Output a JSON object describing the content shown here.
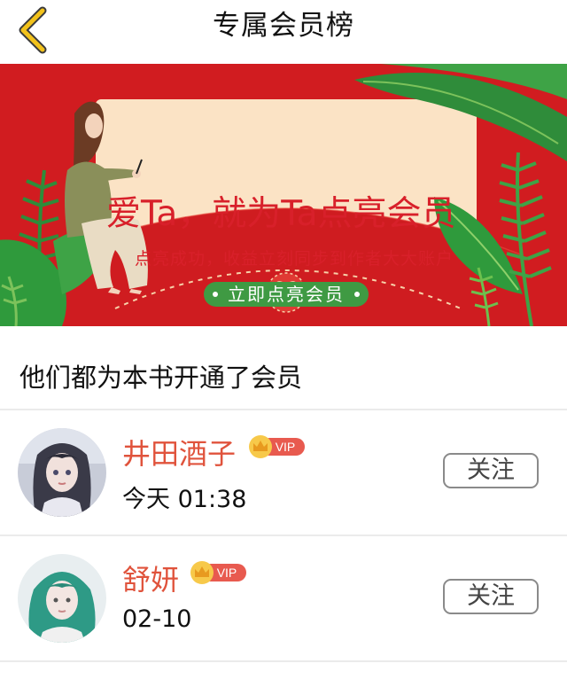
{
  "header": {
    "title": "专属会员榜",
    "back_icon": "chevron-left-icon",
    "back_color": "#f2c21b"
  },
  "banner": {
    "headline": "爱Ta，就为Ta点亮会员",
    "subline": "点亮成功，收益立刻同步到作者大大账户",
    "cta_label": "立即点亮会员",
    "background_color": "#d41e22",
    "card_color": "#fbe3c5",
    "cta_color": "#3f9a43",
    "seal_icon": "heart-seal-icon"
  },
  "section": {
    "title": "他们都为本书开通了会员"
  },
  "members": [
    {
      "name": "井田酒子",
      "badge": "VIP",
      "time": "今天 01:38",
      "follow_label": "关注"
    },
    {
      "name": "舒妍",
      "badge": "VIP",
      "time": "02-10",
      "follow_label": "关注"
    }
  ],
  "colors": {
    "name_color": "#e0533c",
    "vip_badge_color": "#e85a4f",
    "crown_color": "#f3b82a"
  }
}
